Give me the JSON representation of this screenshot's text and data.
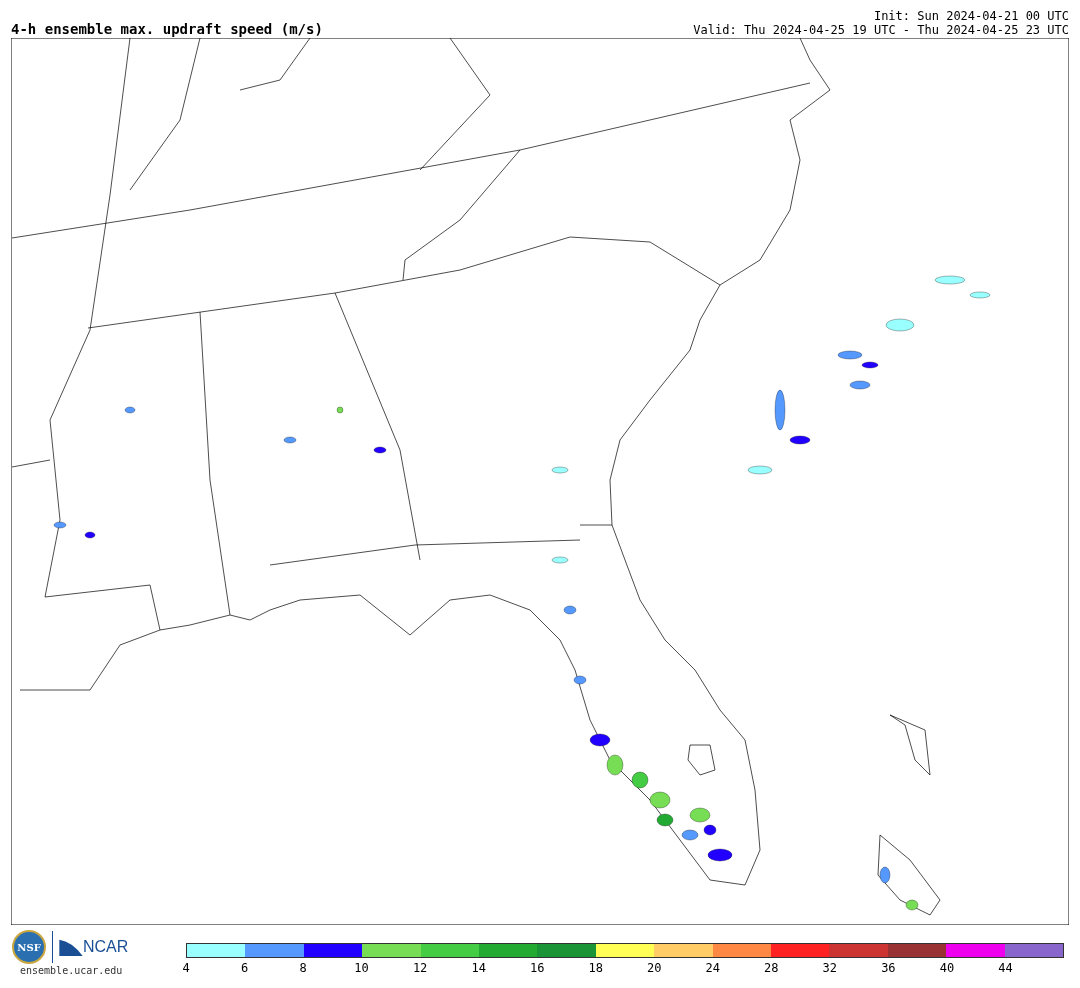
{
  "title": "4-h ensemble max. updraft speed (m/s)",
  "init": "Init: Sun 2024-04-21 00 UTC",
  "valid": "Valid: Thu 2024-04-25 19 UTC - Thu 2024-04-25 23 UTC",
  "logos": {
    "nsf": "NSF",
    "ncar": "NCAR",
    "site": "ensemble.ucar.edu"
  },
  "legend": [
    {
      "color": "#99ffff",
      "tick": "4"
    },
    {
      "color": "#5599ff",
      "tick": "6"
    },
    {
      "color": "#2200ff",
      "tick": "8"
    },
    {
      "color": "#77dd55",
      "tick": "10"
    },
    {
      "color": "#44cc44",
      "tick": "12"
    },
    {
      "color": "#22aa33",
      "tick": "14"
    },
    {
      "color": "#1a9436",
      "tick": "16"
    },
    {
      "color": "#ffff55",
      "tick": "18"
    },
    {
      "color": "#ffcc66",
      "tick": "20"
    },
    {
      "color": "#ff8844",
      "tick": "24"
    },
    {
      "color": "#ff2222",
      "tick": "28"
    },
    {
      "color": "#cc3333",
      "tick": "32"
    },
    {
      "color": "#993333",
      "tick": "36"
    },
    {
      "color": "#ee00ee",
      "tick": "40"
    },
    {
      "color": "#8866cc",
      "tick": "44"
    }
  ]
}
